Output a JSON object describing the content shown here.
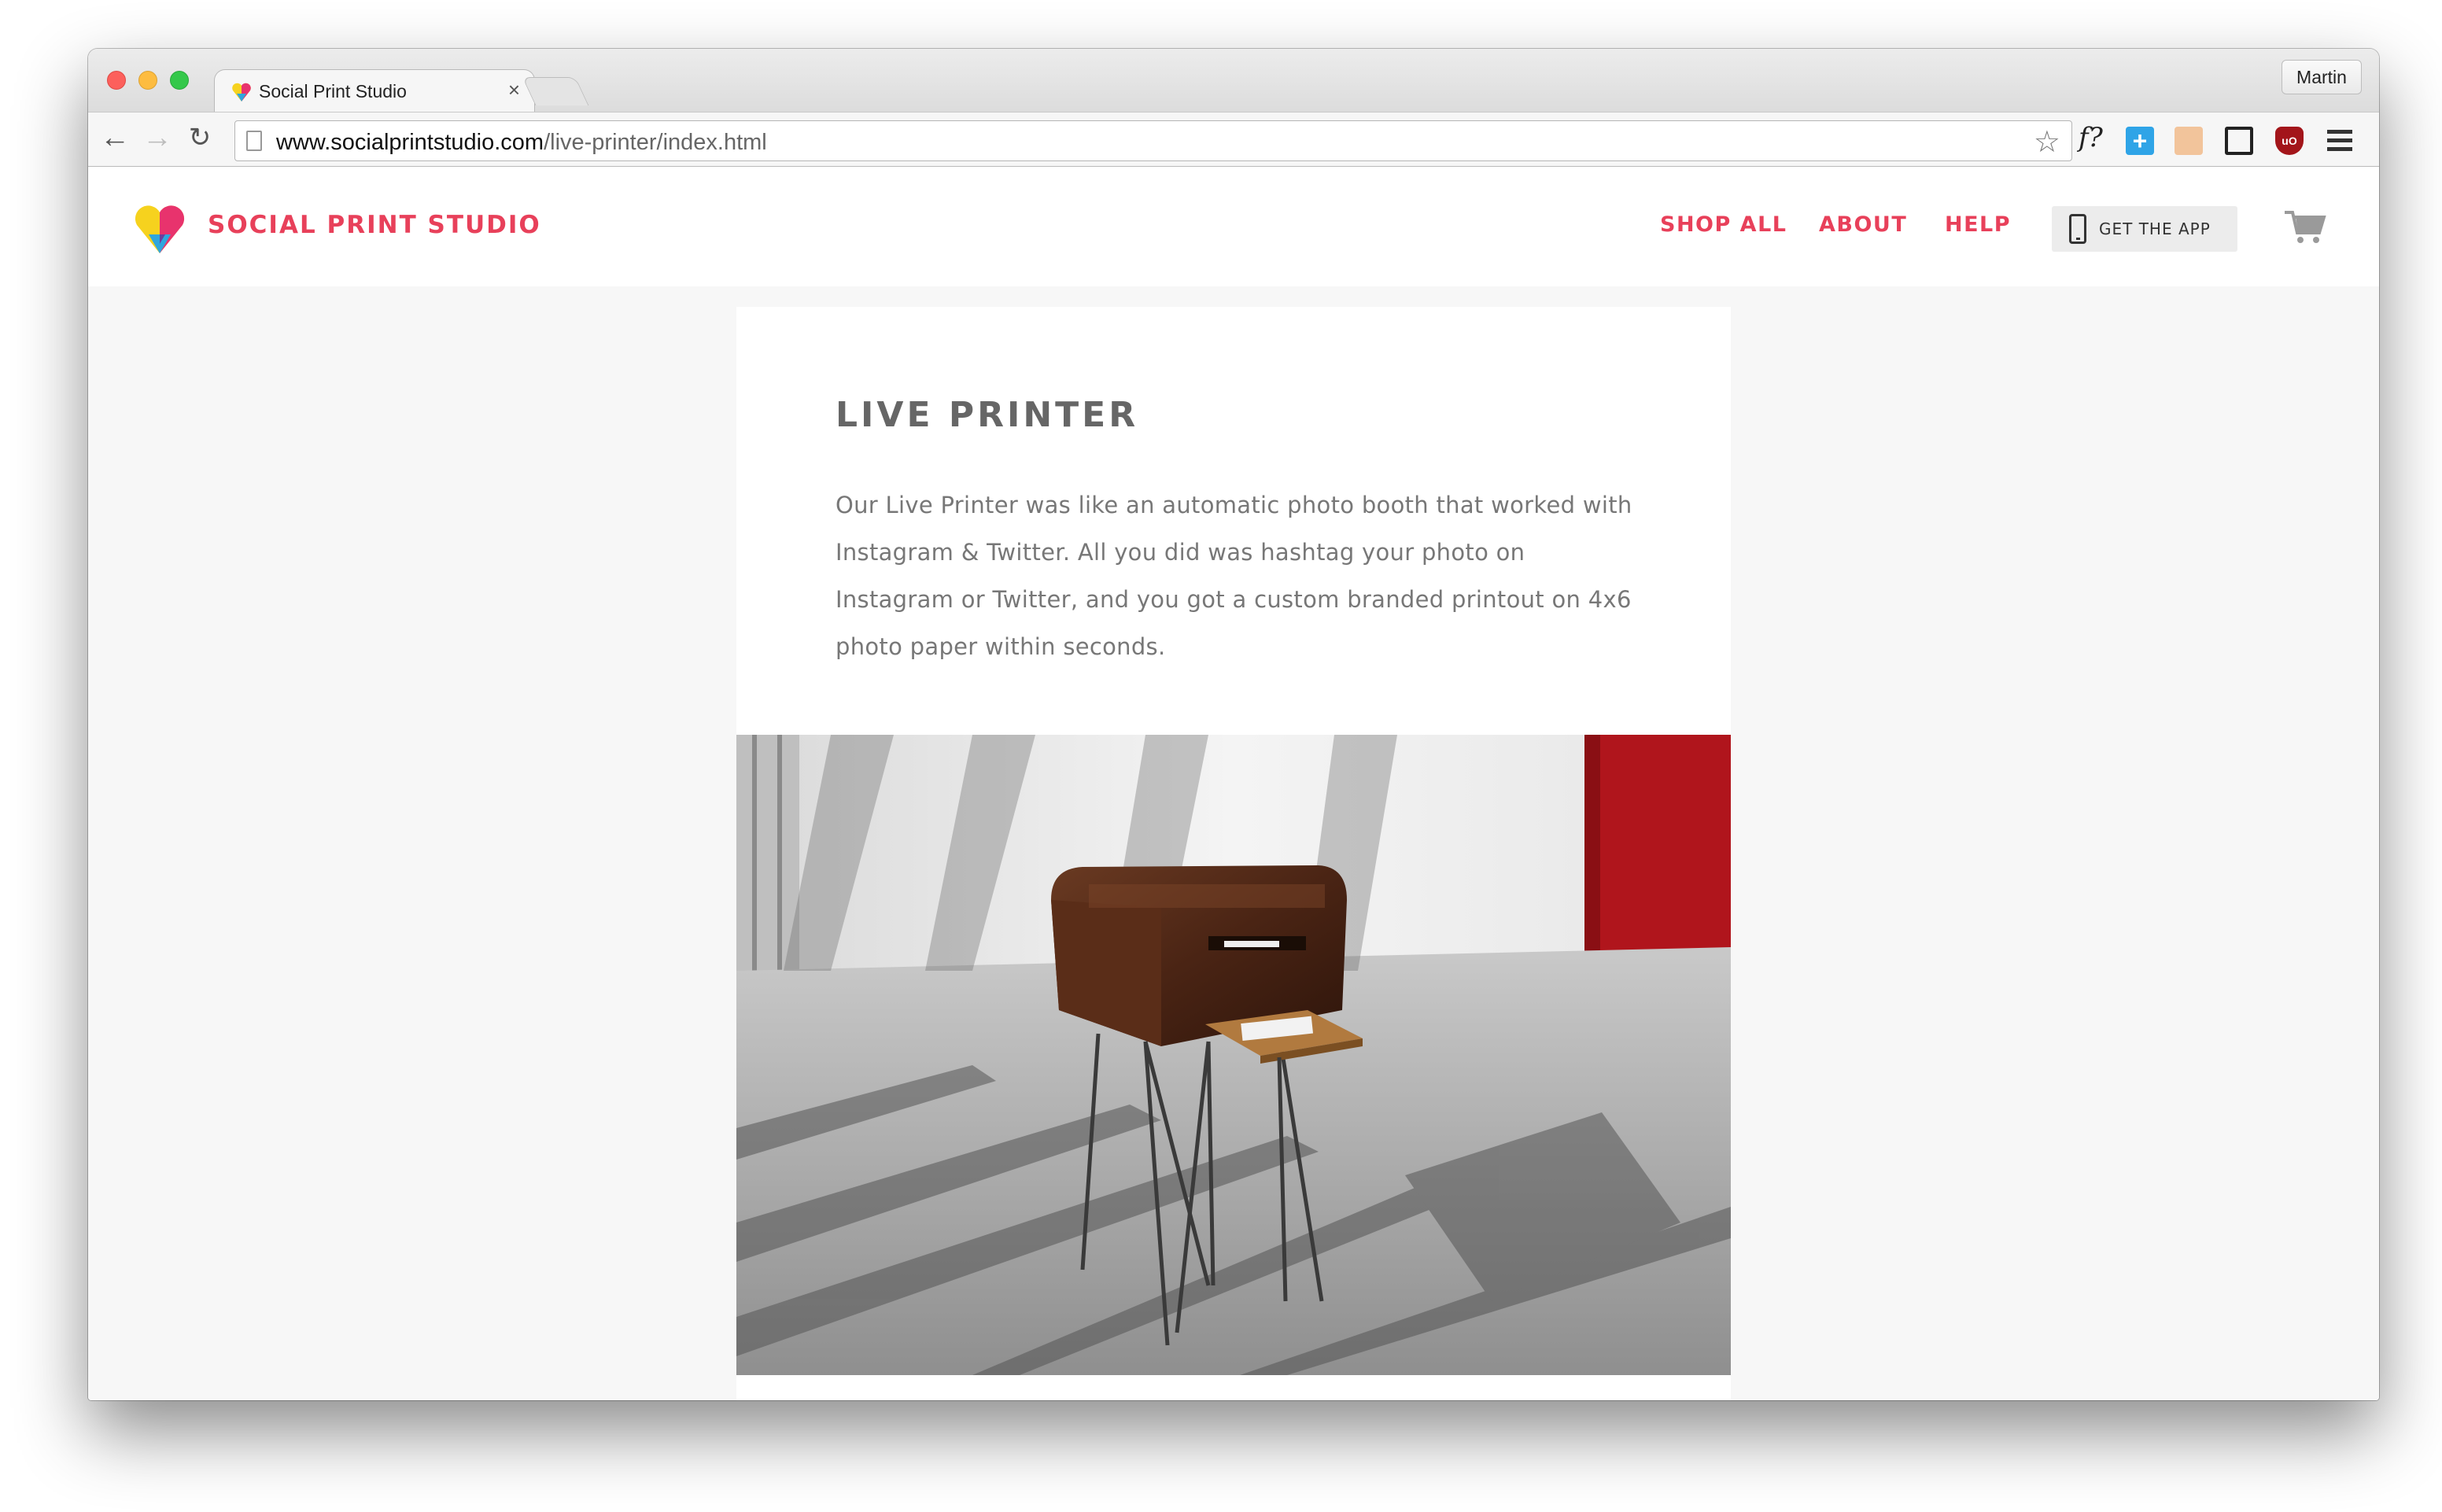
{
  "browser": {
    "tab_title": "Social Print Studio",
    "tab_close": "×",
    "profile_name": "Martin",
    "url_host": "www.socialprintstudio.com",
    "url_path": "/live-printer/index.html",
    "extension_f_label": "f?",
    "extension_plus_label": "+",
    "extension_ub_label": "uO",
    "icons": [
      "back-arrow-icon",
      "forward-arrow-icon",
      "reload-icon",
      "page-icon",
      "star-icon",
      "menu-icon"
    ]
  },
  "site": {
    "brand": "SOCIAL PRINT STUDIO",
    "nav": {
      "shop_all": "SHOP ALL",
      "about": "ABOUT",
      "help": "HELP",
      "get_app": "GET THE APP"
    },
    "colors": {
      "brand": "#e8405a",
      "title": "#666666",
      "body_text": "#777777"
    }
  },
  "main": {
    "title": "LIVE PRINTER",
    "description": "Our Live Printer was like an automatic photo booth that worked with Instagram & Twitter. All you did was hashtag your photo on Instagram or Twitter, and you got a custom branded printout on 4x6 photo paper within seconds."
  }
}
